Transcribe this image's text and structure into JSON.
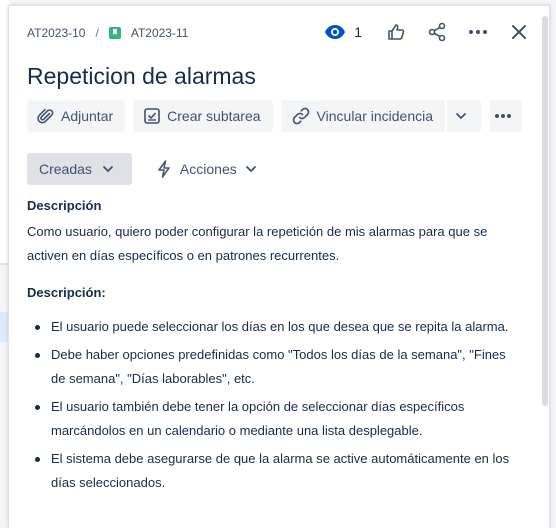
{
  "breadcrumb": {
    "parent_key": "AT2023-10",
    "separator": "/",
    "issue_key": "AT2023-11"
  },
  "header": {
    "watchers_count": "1"
  },
  "issue": {
    "title": "Repeticion de alarmas"
  },
  "toolbar": {
    "attach_label": "Adjuntar",
    "subtask_label": "Crear subtarea",
    "link_issue_label": "Vincular incidencia"
  },
  "status": {
    "current": "Creadas",
    "actions_label": "Acciones"
  },
  "description": {
    "heading": "Descripción",
    "summary": "Como usuario, quiero poder configurar la repetición de mis alarmas para que se activen en días específicos o en patrones recurrentes.",
    "subheading": "Descripción:",
    "items": [
      "El usuario puede seleccionar los días en los que desea que se repita la alarma.",
      "Debe haber opciones predefinidas como \"Todos los días de la semana\", \"Fines de semana\", \"Días laborables\", etc.",
      "El usuario también debe tener la opción de seleccionar días específicos marcándolos en un calendario o mediante una lista desplegable.",
      "El sistema debe asegurarse de que la alarma se active automáticamente en los días seleccionados."
    ]
  },
  "colors": {
    "watch_accent": "#0052cc",
    "story_icon": "#36b37e",
    "text": "#172b4d",
    "subtle_text": "#42526e"
  },
  "icons": [
    "eye-icon",
    "thumbs-up-icon",
    "share-icon",
    "more-icon",
    "close-icon",
    "paperclip-icon",
    "subtask-icon",
    "link-icon",
    "chevron-down-icon",
    "lightning-icon",
    "story-icon"
  ]
}
